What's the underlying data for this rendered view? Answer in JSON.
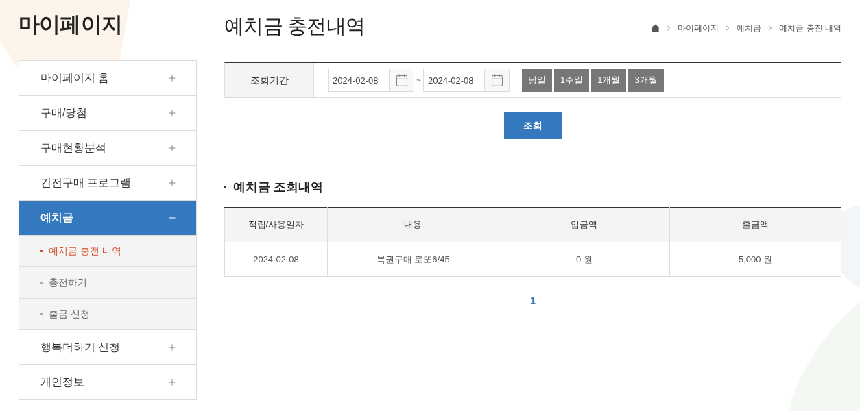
{
  "sidebar": {
    "title": "마이페이지",
    "items": [
      {
        "label": "마이페이지 홈",
        "expanded": false
      },
      {
        "label": "구매/당첨",
        "expanded": false
      },
      {
        "label": "구매현황분석",
        "expanded": false
      },
      {
        "label": "건전구매 프로그램",
        "expanded": false
      },
      {
        "label": "예치금",
        "expanded": true,
        "children": [
          {
            "label": "예치금 충전 내역",
            "selected": true
          },
          {
            "label": "충전하기",
            "selected": false
          },
          {
            "label": "출금 신청",
            "selected": false
          }
        ]
      },
      {
        "label": "행복더하기 신청",
        "expanded": false
      },
      {
        "label": "개인정보",
        "expanded": false
      }
    ]
  },
  "page_title": "예치금 충전내역",
  "breadcrumb": [
    "마이페이지",
    "예치금",
    "예치금 충전 내역"
  ],
  "filter": {
    "label": "조회기간",
    "start_date": "2024-02-08",
    "separator": "~",
    "end_date": "2024-02-08",
    "quick_buttons": [
      "당일",
      "1주일",
      "1개월",
      "3개월"
    ],
    "search_button": "조회"
  },
  "section_title": "예치금 조회내역",
  "table": {
    "columns": [
      "적립/사용일자",
      "내용",
      "입금액",
      "출금액"
    ],
    "rows": [
      [
        "2024-02-08",
        "복권구매 로또6/45",
        "0 원",
        "5,000 원"
      ]
    ]
  },
  "pagination": [
    {
      "label": "1",
      "selected": true
    }
  ]
}
